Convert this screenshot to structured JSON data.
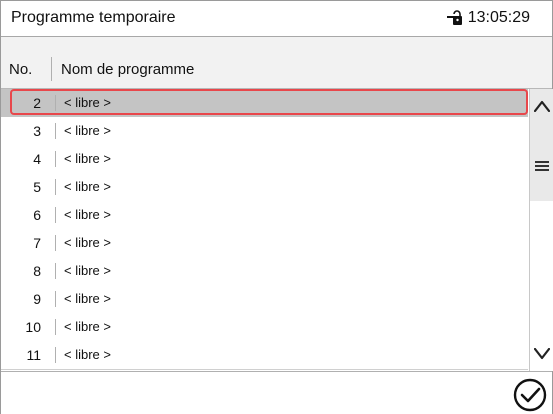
{
  "header": {
    "title": "Programme temporaire",
    "time": "13:05:29",
    "lock_icon": "lock-icon"
  },
  "columns": {
    "no": "No.",
    "name": "Nom de programme"
  },
  "rows": [
    {
      "no": "2",
      "name": "< libre >",
      "selected": true
    },
    {
      "no": "3",
      "name": "< libre >"
    },
    {
      "no": "4",
      "name": "< libre >"
    },
    {
      "no": "5",
      "name": "< libre >"
    },
    {
      "no": "6",
      "name": "< libre >"
    },
    {
      "no": "7",
      "name": "< libre >"
    },
    {
      "no": "8",
      "name": "< libre >"
    },
    {
      "no": "9",
      "name": "< libre >"
    },
    {
      "no": "10",
      "name": "< libre >"
    },
    {
      "no": "11",
      "name": "< libre >"
    }
  ],
  "colors": {
    "selection_outline": "#e8474b",
    "selected_row": "#c4c4c4",
    "header_bg": "#f2f2f2"
  },
  "icons": {
    "scroll_up": "chevron-up-icon",
    "scroll_down": "chevron-down-icon",
    "menu": "menu-icon",
    "confirm": "checkmark-circle-icon"
  }
}
